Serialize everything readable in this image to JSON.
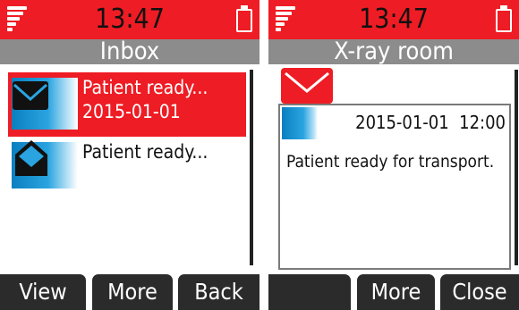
{
  "colors": {
    "accent_red": "#ee1c24",
    "title_gray": "#8c8c8c",
    "softkey_dark": "#2b2b2b",
    "thumb_blue": "#0a7fc0"
  },
  "screens": [
    {
      "status": {
        "time": "13:47",
        "signal_icon": "signal-strength-icon",
        "battery_icon": "battery-icon"
      },
      "title": "Inbox",
      "messages": [
        {
          "line1": "Patient ready...",
          "line2": "2015-01-01",
          "icon": "envelope-closed-icon",
          "selected": true
        },
        {
          "line1": "Patient ready...",
          "line2": "",
          "icon": "envelope-open-icon",
          "selected": false
        }
      ],
      "softkeys": [
        "View",
        "More",
        "Back"
      ]
    },
    {
      "status": {
        "time": "13:47",
        "signal_icon": "signal-strength-icon",
        "battery_icon": "battery-icon"
      },
      "title": "X-ray room",
      "message_icon": "envelope-icon",
      "detail": {
        "date": "2015-01-01",
        "time": "12:00",
        "body": "Patient ready for transport."
      },
      "softkeys": [
        "",
        "More",
        "Close"
      ]
    }
  ]
}
